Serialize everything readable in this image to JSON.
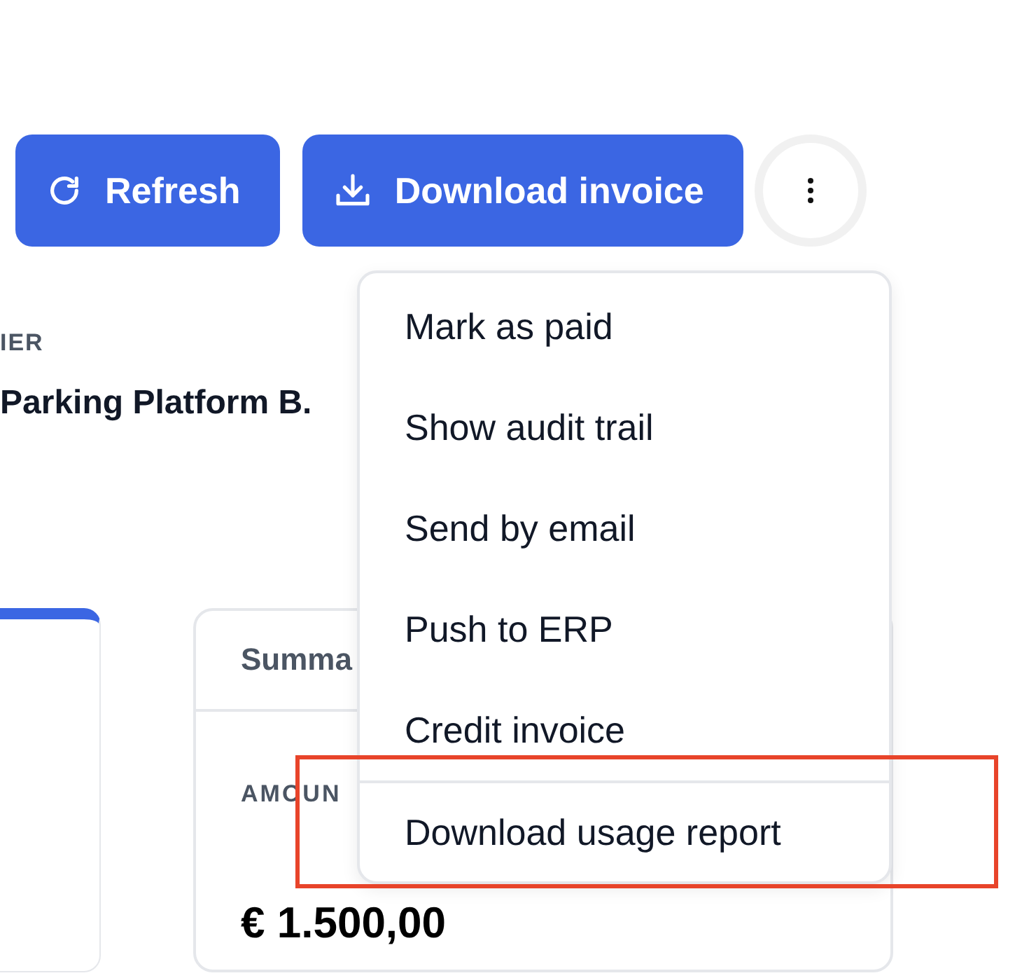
{
  "toolbar": {
    "buttons": [
      {
        "kind": "refresh",
        "label": "Refresh"
      },
      {
        "kind": "download",
        "label": "Download invoice"
      }
    ]
  },
  "customer": {
    "label": "IER",
    "name": "Parking Platform B."
  },
  "summary_card": {
    "title": "Summa",
    "amount_label": "AMOUN",
    "amount": "€ 1.500,00"
  },
  "more_menu": {
    "expanded": true,
    "items": [
      {
        "label": "Mark as paid",
        "separated": false
      },
      {
        "label": "Show audit trail",
        "separated": false
      },
      {
        "label": "Send by email",
        "separated": false
      },
      {
        "label": "Push to ERP",
        "separated": false
      },
      {
        "label": "Credit invoice",
        "separated": false
      },
      {
        "label": "Download usage report",
        "separated": true
      }
    ]
  }
}
